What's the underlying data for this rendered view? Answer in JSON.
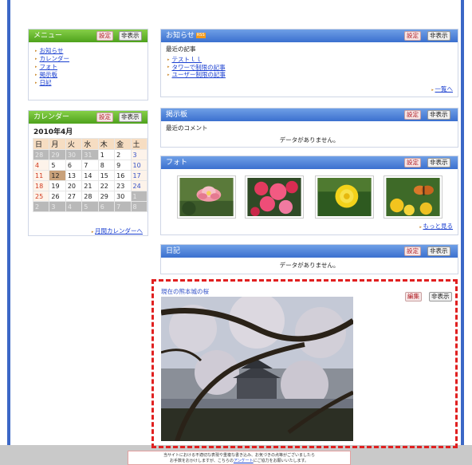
{
  "menu": {
    "title": "メニュー",
    "settings_label": "設定",
    "hide_label": "非表示",
    "items": [
      "お知らせ",
      "カレンダー",
      "フォト",
      "掲示板",
      "日記"
    ]
  },
  "calendar": {
    "title": "カレンダー",
    "settings_label": "設定",
    "hide_label": "非表示",
    "month_label": "2010年4月",
    "weekdays": [
      "日",
      "月",
      "火",
      "水",
      "木",
      "金",
      "土"
    ],
    "weeks": [
      [
        "28",
        "29",
        "30",
        "31",
        "1",
        "2",
        "3"
      ],
      [
        "4",
        "5",
        "6",
        "7",
        "8",
        "9",
        "10"
      ],
      [
        "11",
        "12",
        "13",
        "14",
        "15",
        "16",
        "17"
      ],
      [
        "18",
        "19",
        "20",
        "21",
        "22",
        "23",
        "24"
      ],
      [
        "25",
        "26",
        "27",
        "28",
        "29",
        "30",
        "1"
      ],
      [
        "2",
        "3",
        "4",
        "5",
        "6",
        "7",
        "8"
      ]
    ],
    "monthly_link": "月間カレンダーへ"
  },
  "notice": {
    "title": "お知らせ",
    "rss_badge": "RSS",
    "settings_label": "設定",
    "hide_label": "非表示",
    "subtitle": "最近の記事",
    "items": [
      "テストｌｌ",
      "タワーで制限の記事",
      "ユーザー制限の記事"
    ],
    "list_link": "一覧へ"
  },
  "board": {
    "title": "掲示板",
    "settings_label": "設定",
    "hide_label": "非表示",
    "subtitle": "最近のコメント",
    "empty_text": "データがありません。"
  },
  "photo": {
    "title": "フォト",
    "settings_label": "設定",
    "hide_label": "非表示",
    "more_link": "もっと見る"
  },
  "diary": {
    "title": "日記",
    "settings_label": "設定",
    "hide_label": "非表示",
    "empty_text": "データがありません。"
  },
  "featured": {
    "caption": "現在の熊本城の桜",
    "edit_label": "編集",
    "hide_label": "非表示"
  },
  "footer": {
    "line1": "当サイトにおける不適切な表現や重複な書き込み、お気づきの点等がございましたら",
    "line2_pre": "お手数をおかけしますが、こちらの",
    "link": "アンケート",
    "line2_post": "にご協力をお願いいたします。"
  }
}
